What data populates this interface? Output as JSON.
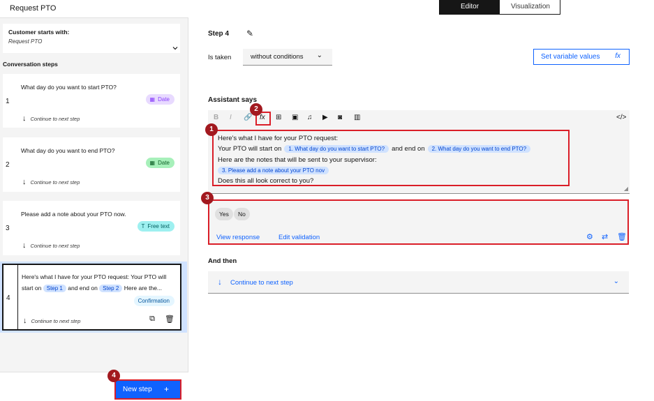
{
  "action": {
    "title": "Request PTO"
  },
  "customer": {
    "label": "Customer starts with:",
    "value": "Request PTO"
  },
  "sidebar": {
    "heading": "Conversation steps",
    "continue_label": "Continue to next step",
    "steps": [
      {
        "number": "1",
        "text": "What day do you want to start PTO?",
        "badge": "Date",
        "badge_icon": "calendar-icon"
      },
      {
        "number": "2",
        "text": "What day do you want to end PTO?",
        "badge": "Date",
        "badge_icon": "calendar-icon"
      },
      {
        "number": "3",
        "text": "Please add a note about your PTO now.",
        "badge": "Free text",
        "badge_icon": "text-icon"
      },
      {
        "number": "4",
        "text_a": "Here's what I have for your PTO request: Your PTO will",
        "text_b1": "start on",
        "chip1": "Step 1",
        "text_b2": "and end on",
        "chip2": "Step 2",
        "text_b3": "Here are the...",
        "badge": "Confirmation"
      }
    ],
    "new_step_label": "New step"
  },
  "tabs": {
    "editor": "Editor",
    "visualization": "Visualization",
    "active": "Editor"
  },
  "editor": {
    "step_title": "Step 4",
    "is_taken_label": "Is taken",
    "condition_value": "without conditions",
    "set_variable_label": "Set variable values",
    "assistant_says_label": "Assistant says",
    "toolbar": [
      "bold-icon",
      "italic-icon",
      "link-icon",
      "function-icon",
      "variable-icon",
      "image-icon",
      "audio-icon",
      "video-icon",
      "iframe-icon",
      "columns-icon",
      "code-icon"
    ],
    "response": {
      "line1": "Here's what I have for your PTO request:",
      "line2_a": "Your PTO will start on",
      "line2_chip1": "1. What day do you want to start PTO?",
      "line2_b": "and end on",
      "line2_chip2": "2. What day do you want to end PTO?",
      "line3": "Here are the notes that will be sent to your supervisor:",
      "line4_chip": "3. Please add a note about your PTO nov",
      "line5": "Does this all look correct to you?"
    },
    "options": {
      "yes": "Yes",
      "no": "No",
      "view_response": "View response",
      "edit_validation": "Edit validation"
    },
    "and_then_label": "And then",
    "next_step_label": "Continue to next step"
  },
  "callouts": [
    "1",
    "2",
    "3",
    "4"
  ],
  "colors": {
    "primary": "#0f62fe",
    "highlight": "#da1e28",
    "callout": "#a2191f"
  }
}
